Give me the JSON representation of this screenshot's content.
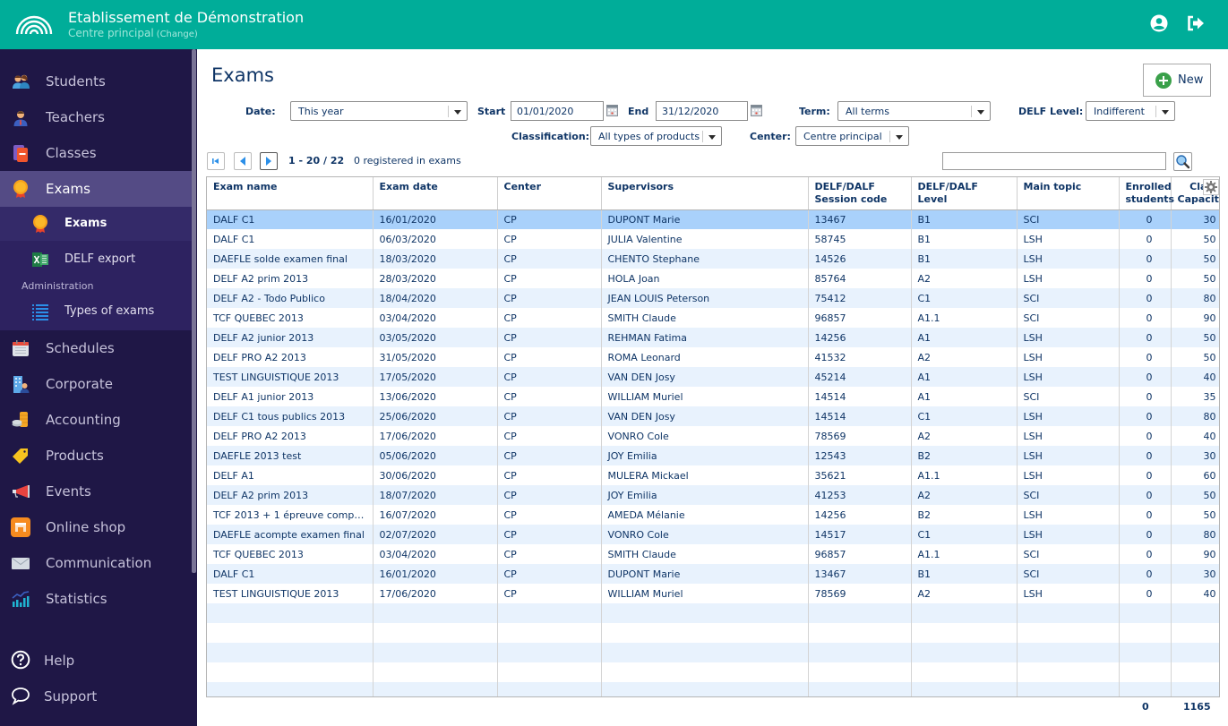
{
  "header": {
    "title": "Etablissement de Démonstration",
    "subtitle": "Centre principal",
    "change_link": "(Change)",
    "icons": [
      "user-account-icon",
      "logout-icon"
    ]
  },
  "sidebar": {
    "items": [
      {
        "label": "Students",
        "icon": "students-icon"
      },
      {
        "label": "Teachers",
        "icon": "teacher-icon"
      },
      {
        "label": "Classes",
        "icon": "book-icon"
      },
      {
        "label": "Exams",
        "icon": "medal-icon",
        "active": true
      },
      {
        "label": "Schedules",
        "icon": "calendar-icon"
      },
      {
        "label": "Corporate",
        "icon": "building-icon"
      },
      {
        "label": "Accounting",
        "icon": "coins-icon"
      },
      {
        "label": "Products",
        "icon": "tag-icon"
      },
      {
        "label": "Events",
        "icon": "megaphone-icon"
      },
      {
        "label": "Online shop",
        "icon": "shop-icon"
      },
      {
        "label": "Communication",
        "icon": "envelope-icon"
      },
      {
        "label": "Statistics",
        "icon": "chart-icon"
      }
    ],
    "sub_items": [
      {
        "label": "Exams",
        "icon": "medal-icon",
        "active": true
      },
      {
        "label": "DELF export",
        "icon": "excel-icon"
      }
    ],
    "sub_heading": "Administration",
    "admin_items": [
      {
        "label": "Types of exams",
        "icon": "list-icon"
      }
    ],
    "footer": [
      {
        "label": "Help",
        "icon": "help-icon"
      },
      {
        "label": "Support",
        "icon": "chat-icon"
      }
    ]
  },
  "page": {
    "title": "Exams",
    "new_button": "New"
  },
  "filters": {
    "date_label": "Date:",
    "date_value": "This year",
    "start_label": "Start",
    "start_value": "01/01/2020",
    "end_label": "End",
    "end_value": "31/12/2020",
    "term_label": "Term:",
    "term_value": "All terms",
    "delf_label": "DELF Level:",
    "delf_value": "Indifferent",
    "classification_label": "Classification:",
    "classification_value": "All types of products",
    "center_label": "Center:",
    "center_value": "Centre principal"
  },
  "pagination": {
    "range": "1 - 20 / 22",
    "registered": "0 registered in exams",
    "search_value": ""
  },
  "table": {
    "columns": [
      "Exam name",
      "Exam date",
      "Center",
      "Supervisors",
      "DELF/DALF Session code",
      "DELF/DALF Level",
      "Main topic",
      "Enrolled students",
      "Class Capacity"
    ],
    "rows": [
      [
        "DALF C1",
        "16/01/2020",
        "CP",
        "DUPONT Marie",
        "13467",
        "B1",
        "SCI",
        "0",
        "30"
      ],
      [
        "DALF C1",
        "06/03/2020",
        "CP",
        "JULIA Valentine",
        "58745",
        "B1",
        "LSH",
        "0",
        "50"
      ],
      [
        "DAEFLE solde examen final",
        "18/03/2020",
        "CP",
        "CHENTO Stephane",
        "14526",
        "B1",
        "LSH",
        "0",
        "50"
      ],
      [
        "DELF A2 prim 2013",
        "28/03/2020",
        "CP",
        "HOLA Joan",
        "85764",
        "A2",
        "LSH",
        "0",
        "50"
      ],
      [
        "DELF A2 - Todo Publico",
        "18/04/2020",
        "CP",
        "JEAN LOUIS Peterson",
        "75412",
        "C1",
        "SCI",
        "0",
        "80"
      ],
      [
        "TCF QUEBEC 2013",
        "03/04/2020",
        "CP",
        "SMITH Claude",
        "96857",
        "A1.1",
        "SCI",
        "0",
        "90"
      ],
      [
        "DELF A2 junior 2013",
        "03/05/2020",
        "CP",
        "REHMAN Fatima",
        "14256",
        "A1",
        "LSH",
        "0",
        "50"
      ],
      [
        "DELF PRO A2 2013",
        "31/05/2020",
        "CP",
        "ROMA Leonard",
        "41532",
        "A2",
        "LSH",
        "0",
        "50"
      ],
      [
        "TEST LINGUISTIQUE 2013",
        "17/05/2020",
        "CP",
        "VAN DEN Josy",
        "45214",
        "A1",
        "LSH",
        "0",
        "40"
      ],
      [
        "DELF A1 junior 2013",
        "13/06/2020",
        "CP",
        "WILLIAM Muriel",
        "14514",
        "A1",
        "SCI",
        "0",
        "35"
      ],
      [
        "DELF C1 tous publics 2013",
        "25/06/2020",
        "CP",
        "VAN DEN Josy",
        "14514",
        "C1",
        "LSH",
        "0",
        "80"
      ],
      [
        "DELF PRO A2 2013",
        "17/06/2020",
        "CP",
        "VONRO Cole",
        "78569",
        "A2",
        "LSH",
        "0",
        "40"
      ],
      [
        "DAEFLE 2013 test",
        "05/06/2020",
        "CP",
        "JOY Emilia",
        "12543",
        "B2",
        "LSH",
        "0",
        "30"
      ],
      [
        "DELF A1",
        "30/06/2020",
        "CP",
        "MULERA Mickael",
        "35621",
        "A1.1",
        "LSH",
        "0",
        "60"
      ],
      [
        "DELF A2 prim 2013",
        "18/07/2020",
        "CP",
        "JOY Emilia",
        "41253",
        "A2",
        "SCI",
        "0",
        "50"
      ],
      [
        "TCF 2013 + 1 épreuve complé...",
        "16/07/2020",
        "CP",
        "AMEDA Mélanie",
        "14256",
        "B2",
        "LSH",
        "0",
        "50"
      ],
      [
        "DAEFLE acompte examen final",
        "02/07/2020",
        "CP",
        "VONRO Cole",
        "14517",
        "C1",
        "LSH",
        "0",
        "80"
      ],
      [
        "TCF QUEBEC 2013",
        "03/04/2020",
        "CP",
        "SMITH Claude",
        "96857",
        "A1.1",
        "SCI",
        "0",
        "90"
      ],
      [
        "DALF C1",
        "16/01/2020",
        "CP",
        "DUPONT Marie",
        "13467",
        "B1",
        "SCI",
        "0",
        "30"
      ],
      [
        "TEST LINGUISTIQUE 2013",
        "17/06/2020",
        "CP",
        "WILLIAM Muriel",
        "78569",
        "A2",
        "LSH",
        "0",
        "40"
      ]
    ],
    "selected_row": 0,
    "totals": {
      "enrolled": "0",
      "capacity": "1165"
    }
  },
  "colors": {
    "header": "#00ad99",
    "sidebar": "#1f1746",
    "sidebar_active": "#544b85",
    "row_selected": "#a9d1fb",
    "row_alt": "#e8f2fd",
    "text": "#0f3566"
  }
}
